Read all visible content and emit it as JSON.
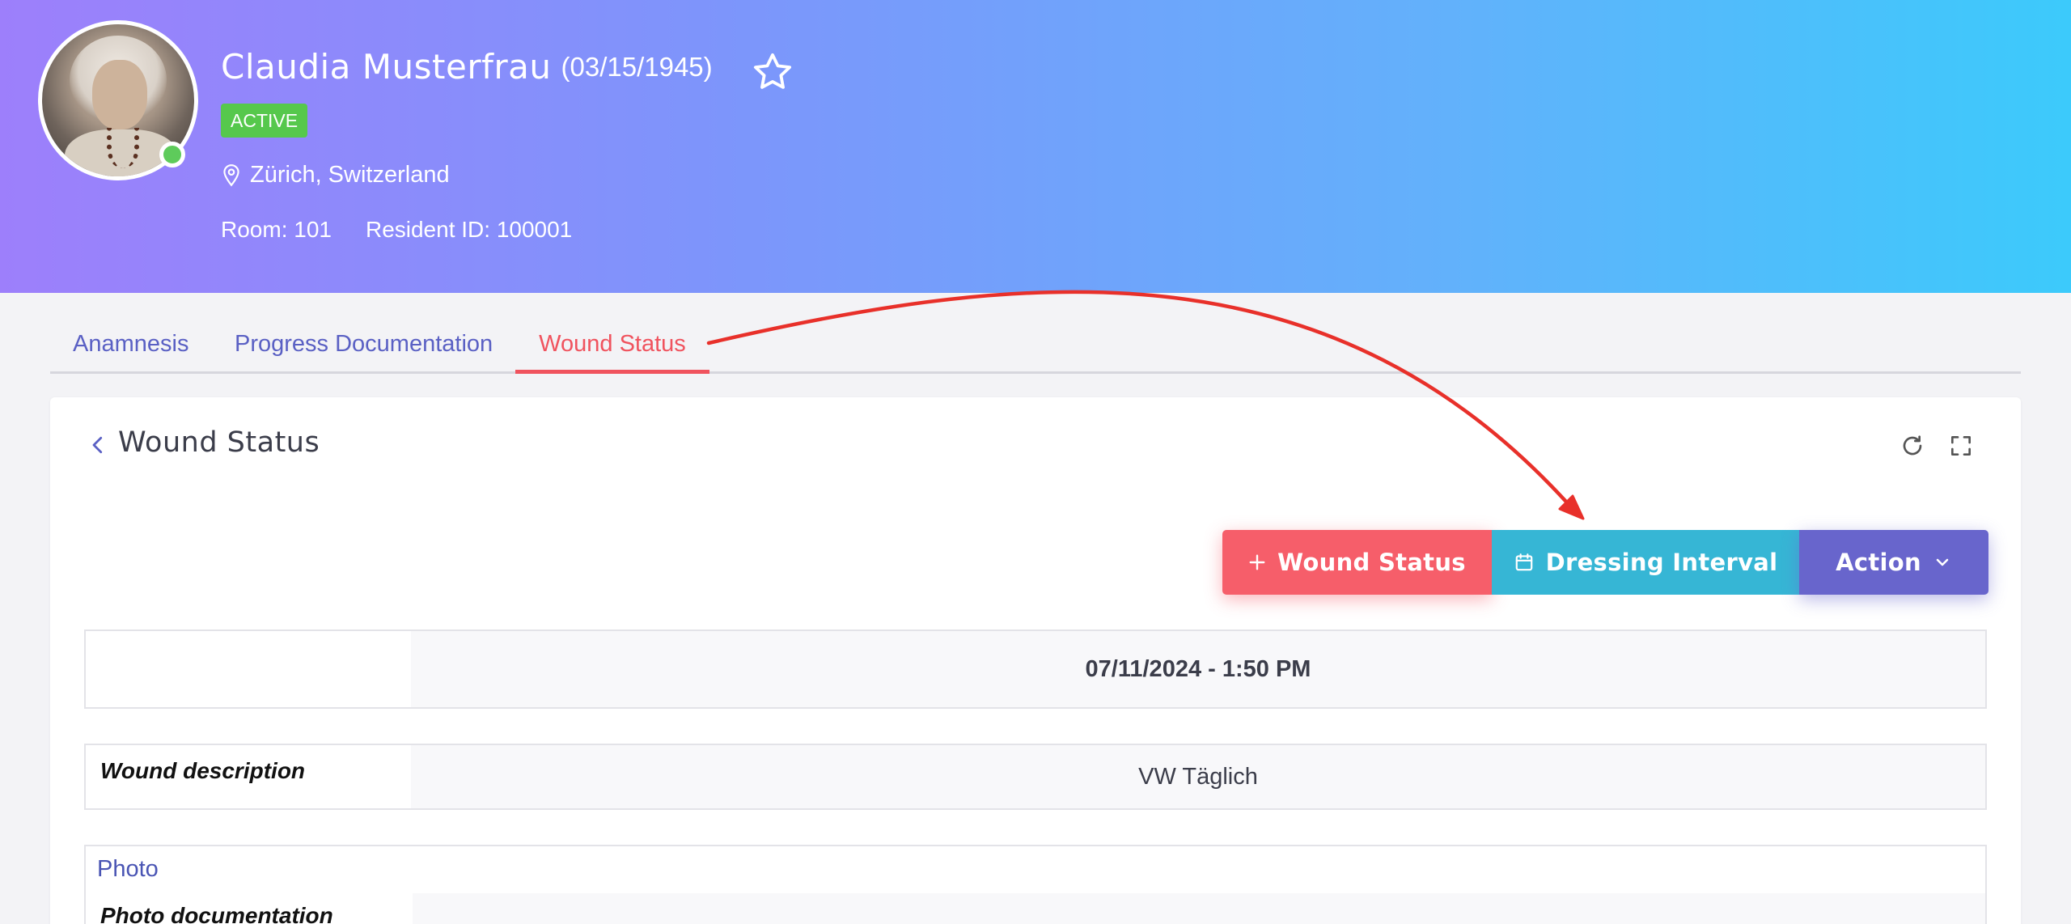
{
  "patient": {
    "name": "Claudia Musterfrau",
    "dob": "(03/15/1945)",
    "status": "ACTIVE",
    "location": "Zürich, Switzerland",
    "room": "Room: 101",
    "resident_id": "Resident ID: 100001"
  },
  "tabs": [
    {
      "label": "Anamnesis",
      "active": false
    },
    {
      "label": "Progress Documentation",
      "active": false
    },
    {
      "label": "Wound Status",
      "active": true
    }
  ],
  "card": {
    "title": "Wound Status",
    "buttons": {
      "add_wound_status": "Wound Status",
      "dressing_interval": "Dressing Interval",
      "action": "Action"
    },
    "entry": {
      "date": "07/11/2024 - 1:50 PM",
      "wound_description_label": "Wound description",
      "wound_description_value": "VW Täglich",
      "photo_section": "Photo",
      "photo_documentation_label": "Photo documentation"
    }
  },
  "colors": {
    "active_badge": "#56c84c",
    "active_tab": "#f0535e",
    "tab_text": "#5a60c4",
    "btn_wound": "#f65e6a",
    "btn_dressing": "#36b6d5",
    "btn_action": "#6865cc",
    "annotation_arrow": "#e8302a"
  },
  "icons": [
    "star-icon",
    "location-pin-icon",
    "chevron-left-icon",
    "refresh-icon",
    "fullscreen-icon",
    "plus-icon",
    "calendar-icon",
    "chevron-down-icon",
    "online-status-dot"
  ]
}
